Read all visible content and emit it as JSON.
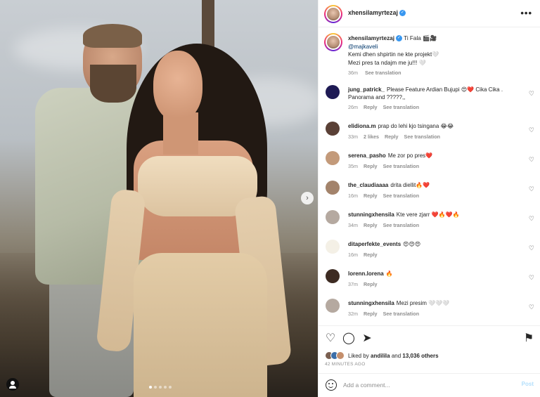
{
  "post": {
    "username": "xhensilamyrtezaj",
    "more_label": "•••"
  },
  "media": {
    "dots_total": 5,
    "active_dot": 0,
    "next_label": "›"
  },
  "caption": {
    "username": "xhensilamyrtezaj",
    "line1": "Ti Fala 🎬🎥",
    "mention": "@majkaveli",
    "line2": "Kemi dhen shpirtin ne kte projekt🤍",
    "line3": "Mezi pres ta ndajm me ju!!! 🤍",
    "time": "36m",
    "see_translation": "See translation"
  },
  "comments": [
    {
      "user": "jung_patrick_",
      "text": "Please Feature Ardian Bujupi 😍❤️ Cika Cika . Panorama and ?????,,",
      "time": "26m",
      "likes": "",
      "reply": "Reply",
      "see": "See translation",
      "color": "#1e1a54"
    },
    {
      "user": "elidiona.m",
      "text": "prap do lehi kjo tsingana 😂😂",
      "time": "33m",
      "likes": "2 likes",
      "reply": "Reply",
      "see": "See translation",
      "color": "#5a4036"
    },
    {
      "user": "serena_pasho",
      "text": "Me zor po pres❤️",
      "time": "35m",
      "likes": "",
      "reply": "Reply",
      "see": "See translation",
      "color": "#c39a7a"
    },
    {
      "user": "the_claudiaaaa",
      "text": "drita diellit🔥❤️",
      "time": "16m",
      "likes": "",
      "reply": "Reply",
      "see": "See translation",
      "color": "#a3836b"
    },
    {
      "user": "stunningxhensila",
      "text": "Kte vere zjarr ❤️🔥❤️🔥",
      "time": "34m",
      "likes": "",
      "reply": "Reply",
      "see": "See translation",
      "color": "#b5a9a0"
    },
    {
      "user": "ditaperfekte_events",
      "text": "😍😍😍",
      "time": "16m",
      "likes": "",
      "reply": "Reply",
      "see": "",
      "color": "#f4f0e6"
    },
    {
      "user": "lorenn.lorena",
      "text": "🔥",
      "time": "37m",
      "likes": "",
      "reply": "Reply",
      "see": "",
      "color": "#3d2b22"
    },
    {
      "user": "stunningxhensila",
      "text": "Mezi presim 🤍🤍🤍",
      "time": "32m",
      "likes": "",
      "reply": "Reply",
      "see": "See translation",
      "color": "#b5a9a0"
    }
  ],
  "actions": {
    "liked_by_prefix": "Liked by",
    "liked_by_user": "andilila",
    "liked_by_and": "and",
    "others": "13,036 others",
    "time_ago": "42 MINUTES AGO",
    "mini_colors": [
      "#7a5f50",
      "#3b6ea8",
      "#c58f6c"
    ]
  },
  "add_comment": {
    "placeholder": "Add a comment...",
    "post_label": "Post"
  }
}
